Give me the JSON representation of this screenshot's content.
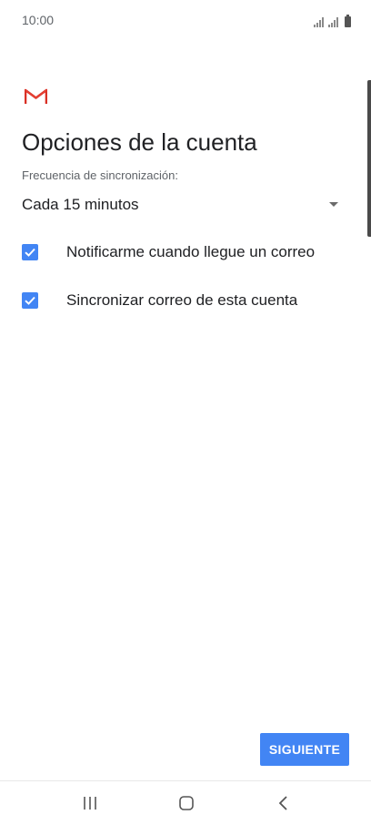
{
  "status_bar": {
    "time": "10:00",
    "icons": [
      "signal-icon",
      "signal-icon",
      "battery-icon"
    ]
  },
  "header": {
    "logo": "gmail-logo-icon",
    "title": "Opciones de la cuenta"
  },
  "sync": {
    "label": "Frecuencia de sincronización:",
    "value": "Cada 15 minutos",
    "icon": "dropdown-arrow-icon"
  },
  "options": [
    {
      "label": "Notificarme cuando llegue un correo",
      "checked": true
    },
    {
      "label": "Sincronizar correo de esta cuenta",
      "checked": true
    }
  ],
  "actions": {
    "next_label": "SIGUIENTE"
  },
  "nav_bar": {
    "icons": [
      "recents-icon",
      "home-icon",
      "back-icon"
    ]
  },
  "colors": {
    "accent": "#4285f4",
    "gmail_red": "#d93025",
    "text_primary": "#202124",
    "text_secondary": "#5f6368"
  }
}
